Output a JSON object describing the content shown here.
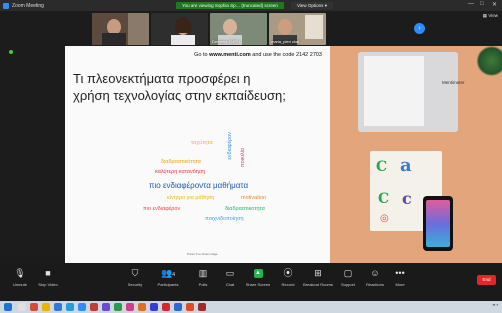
{
  "window": {
    "title": "Zoom Meeting",
    "share_banner": "You are viewing Sophia Sp… (truncated) screen",
    "view_options": "View Options",
    "view_button": "View",
    "min": "—",
    "max": "□",
    "close": "✕"
  },
  "participants": [
    {
      "name": ""
    },
    {
      "name": ""
    },
    {
      "name": "Demetra KMPU…"
    },
    {
      "name": "maria_pleri ckal…"
    }
  ],
  "slide": {
    "instruction_prefix": "Go to ",
    "instruction_url": "www.menti.com",
    "instruction_suffix": " and use the code 2142 2703",
    "title": "Τι πλεονεκτήματα προσφέρει η χρήση τεχνολογίας στην εκπαίδευση;",
    "footer": "Press S to show image",
    "desk_brand": "Mentimeter"
  },
  "word_cloud": [
    {
      "text": "ταχύτητα",
      "color": "#f2b33c"
    },
    {
      "text": "ενδιαφέρον",
      "color": "#4a90d9"
    },
    {
      "text": "ποικιλία",
      "color": "#e0417a"
    },
    {
      "text": "διαδραστικότητα",
      "color": "#f0a020"
    },
    {
      "text": "καλύτερη κατανόηση",
      "color": "#e53935"
    },
    {
      "text": "πιο ενδιαφέροντα μαθήματα",
      "color": "#1e5aa8"
    },
    {
      "text": "κίνητρο για μάθηση",
      "color": "#f5b400"
    },
    {
      "text": "motivation",
      "color": "#f08a24"
    },
    {
      "text": "πιο ενδιαφέρον",
      "color": "#e94b4b"
    },
    {
      "text": "διαδραστικοτητα",
      "color": "#2bb56c"
    },
    {
      "text": "παιχνιδοποίηση",
      "color": "#4aa3e0"
    }
  ],
  "toolbar": {
    "unmute": "Unmute",
    "stop_video": "Stop Video",
    "security": "Security",
    "participants": "Participants",
    "participants_count": "4",
    "polls": "Polls",
    "chat": "Chat",
    "share_screen": "Share Screen",
    "record": "Record",
    "breakout_rooms": "Breakout Rooms",
    "support": "Support",
    "reactions": "Reactions",
    "more": "More",
    "end": "End"
  },
  "colors": {
    "accent": "#2d8cff",
    "share_green": "#27b34a",
    "end_red": "#e02828"
  }
}
